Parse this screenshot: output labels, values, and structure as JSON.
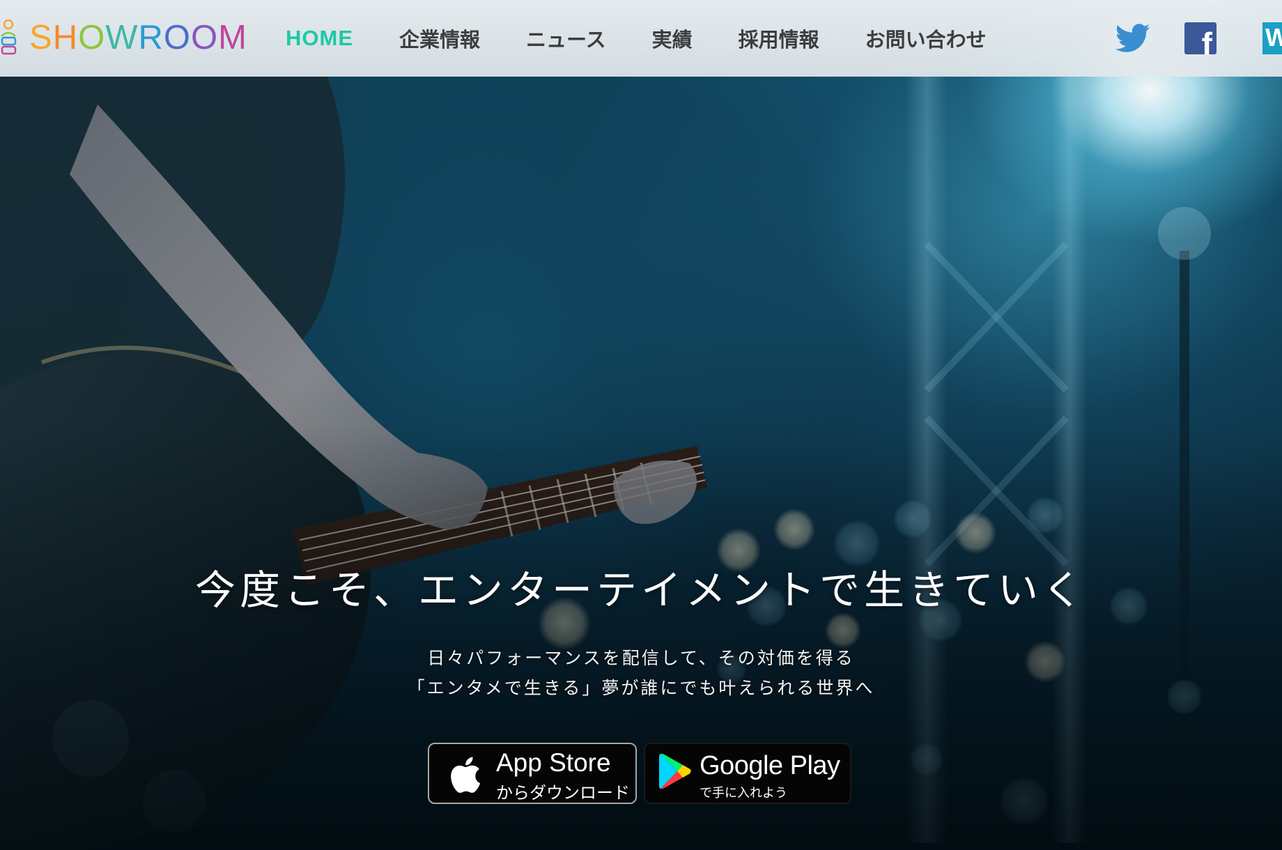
{
  "brand": {
    "name_letters": [
      "S",
      "H",
      "O",
      "W",
      "R",
      "O",
      "O",
      "M"
    ],
    "letter_colors": [
      "#f7a52b",
      "#f58a2a",
      "#8cc63f",
      "#3fb8a6",
      "#2a9ad6",
      "#4a6fc8",
      "#8856c1",
      "#c0469a"
    ]
  },
  "nav": {
    "items": [
      {
        "label": "HOME",
        "active": true
      },
      {
        "label": "企業情報",
        "active": false
      },
      {
        "label": "ニュース",
        "active": false
      },
      {
        "label": "実績",
        "active": false
      },
      {
        "label": "採用情報",
        "active": false
      },
      {
        "label": "お問い合わせ",
        "active": false
      }
    ],
    "active_color": "#1ec8a7"
  },
  "social": {
    "twitter": {
      "icon": "twitter-bird-icon",
      "color": "#3b8fd1"
    },
    "facebook": {
      "icon": "facebook-f-icon",
      "letter": "f",
      "color": "#3b5998"
    },
    "third": {
      "icon": "w-icon",
      "letter": "W",
      "color": "#1aa0c2"
    }
  },
  "hero": {
    "headline": "今度こそ、エンターテイメントで生きていく",
    "subline1": "日々パフォーマンスを配信して、その対価を得る",
    "subline2": "「エンタメで生きる」夢が誰にでも叶えられる世界へ"
  },
  "stores": {
    "apple": {
      "title": "App Store",
      "sub": "からダウンロード",
      "icon": "apple-logo-icon"
    },
    "google": {
      "title": "Google Play",
      "sub": "で手に入れよう",
      "icon": "google-play-icon"
    }
  }
}
